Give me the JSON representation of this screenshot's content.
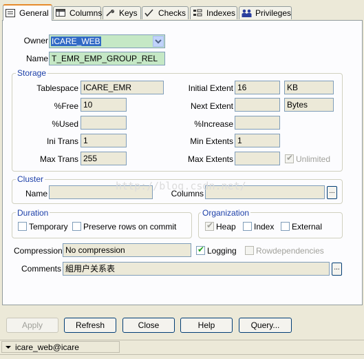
{
  "tabs": [
    {
      "label": "General",
      "icon": "general-icon"
    },
    {
      "label": "Columns",
      "icon": "columns-icon"
    },
    {
      "label": "Keys",
      "icon": "keys-icon"
    },
    {
      "label": "Checks",
      "icon": "checks-icon"
    },
    {
      "label": "Indexes",
      "icon": "indexes-icon"
    },
    {
      "label": "Privileges",
      "icon": "privileges-icon"
    }
  ],
  "general": {
    "owner_label": "Owner",
    "owner_value": "ICARE_WEB",
    "name_label": "Name",
    "name_value": "T_EMR_EMP_GROUP_REL"
  },
  "storage": {
    "title": "Storage",
    "tablespace_label": "Tablespace",
    "tablespace_value": "ICARE_EMR",
    "free_label": "%Free",
    "free_value": "10",
    "used_label": "%Used",
    "used_value": "",
    "initrans_label": "Ini Trans",
    "initrans_value": "1",
    "maxtrans_label": "Max Trans",
    "maxtrans_value": "255",
    "initial_extent_label": "Initial Extent",
    "initial_extent_value": "16",
    "initial_extent_unit": "KB",
    "next_extent_label": "Next Extent",
    "next_extent_value": "",
    "next_extent_unit": "Bytes",
    "increase_label": "%Increase",
    "increase_value": "",
    "min_extents_label": "Min Extents",
    "min_extents_value": "1",
    "max_extents_label": "Max Extents",
    "max_extents_value": "",
    "unlimited_label": "Unlimited"
  },
  "cluster": {
    "title": "Cluster",
    "name_label": "Name",
    "name_value": "",
    "columns_label": "Columns",
    "columns_value": "",
    "ellipsis": "..."
  },
  "watermark": "http://blog.csdn.net/",
  "duration": {
    "title": "Duration",
    "temporary_label": "Temporary",
    "preserve_label": "Preserve rows on commit"
  },
  "organization": {
    "title": "Organization",
    "heap_label": "Heap",
    "index_label": "Index",
    "external_label": "External"
  },
  "misc": {
    "compression_label": "Compression",
    "compression_value": "No compression",
    "logging_label": "Logging",
    "rowdep_label": "Rowdependencies",
    "comments_label": "Comments",
    "comments_value": "組用户关系表",
    "ellipsis": "..."
  },
  "buttons": {
    "apply": "Apply",
    "refresh": "Refresh",
    "close": "Close",
    "help": "Help",
    "query": "Query..."
  },
  "status": {
    "connection": "icare_web@icare"
  },
  "colors": {
    "accent_tab": "#e68b2c",
    "group_title": "#1c3fa8",
    "highlight_field": "#c5e8c5",
    "selection": "#316ac5"
  }
}
